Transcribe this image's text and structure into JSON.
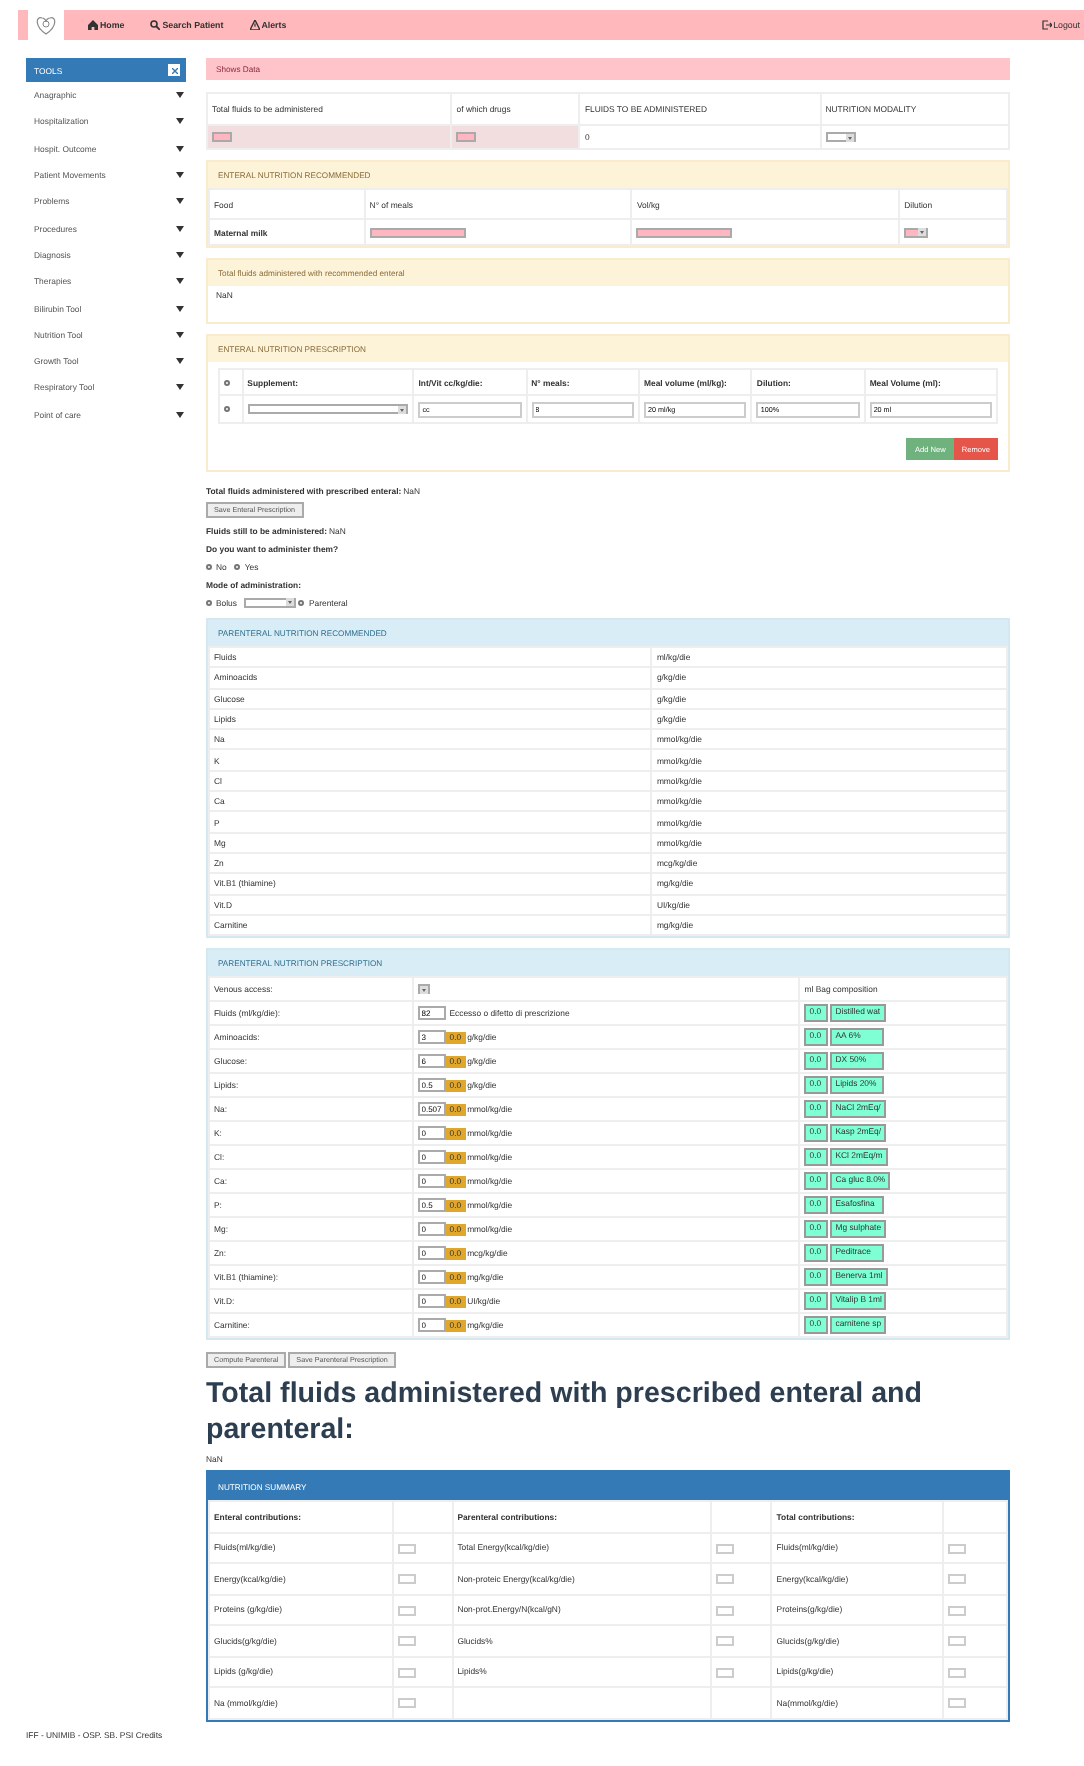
{
  "nav": {
    "links": [
      {
        "kind": "home",
        "label": "Home"
      },
      {
        "kind": "search",
        "label": "Search Patient"
      },
      {
        "kind": "alert",
        "label": "Alerts"
      }
    ],
    "logout": "Logout"
  },
  "sidebar": {
    "title": "TOOLS",
    "items": [
      "Anagraphic",
      "Hospitalization",
      "Hospit. Outcome",
      "Patient Movements",
      "Problems",
      "Procedures",
      "Diagnosis",
      "Therapies",
      "Bilirubin Tool",
      "Nutrition Tool",
      "Growth Tool",
      "Respiratory Tool",
      "Point of care"
    ]
  },
  "shows_data": {
    "title": "Shows Data",
    "columns": [
      "Total fluids to be administered",
      "of which drugs",
      "FLUIDS TO BE ADMINISTERED",
      "NUTRITION MODALITY"
    ],
    "fluids_value": "0"
  },
  "enteral_recommended": {
    "title": "ENTERAL NUTRITION RECOMMENDED",
    "columns": [
      "Food",
      "N° of meals",
      "Vol/kg",
      "Dilution"
    ],
    "food": "Maternal milk"
  },
  "recommended_total": {
    "title": "Total fluids administered with recommended enteral",
    "value": "NaN"
  },
  "enteral_prescription": {
    "title": "ENTERAL NUTRITION PRESCRIPTION",
    "checked": false,
    "columns": [
      "Supplement:",
      "Int/Vit cc/kg/die:",
      "N° meals:",
      "Meal volume (ml/kg):",
      "Dilution:",
      "Meal Volume (ml):"
    ],
    "row": {
      "checked": false,
      "values": [
        "cc",
        "8",
        "20 ml/kg",
        "100%",
        "20 ml"
      ]
    },
    "buttons": [
      {
        "kind": "add",
        "label": "Add New"
      },
      {
        "kind": "remove",
        "label": "Remove"
      }
    ]
  },
  "prescribed_total": {
    "label": "Total fluids administered with prescribed enteral:",
    "value": "NaN"
  },
  "save_enteral": "Save Enteral Prescription",
  "fluids_left": {
    "label": "Fluids still to be administered:",
    "value": "NaN"
  },
  "administer": {
    "question": "Do you want to administer them?",
    "options": [
      {
        "label": "No",
        "selected": false
      },
      {
        "label": "Yes",
        "selected": false
      }
    ]
  },
  "mode": {
    "label": "Mode of administration:",
    "options": [
      {
        "label": "Bolus",
        "selected": false
      },
      {
        "label": "Parenteral",
        "selected": false
      }
    ]
  },
  "parenteral_recommended": {
    "title": "PARENTERAL NUTRITION RECOMMENDED",
    "rows": [
      {
        "name": "Fluids",
        "unit": "ml/kg/die"
      },
      {
        "name": "Aminoacids",
        "unit": "g/kg/die"
      },
      {
        "name": "Glucose",
        "unit": "g/kg/die"
      },
      {
        "name": "Lipids",
        "unit": "g/kg/die"
      },
      {
        "name": "Na",
        "unit": "mmol/kg/die"
      },
      {
        "name": "K",
        "unit": "mmol/kg/die"
      },
      {
        "name": "Cl",
        "unit": "mmol/kg/die"
      },
      {
        "name": "Ca",
        "unit": "mmol/kg/die"
      },
      {
        "name": "P",
        "unit": "mmol/kg/die"
      },
      {
        "name": "Mg",
        "unit": "mmol/kg/die"
      },
      {
        "name": "Zn",
        "unit": "mcg/kg/die"
      },
      {
        "name": "Vit.B1 (thiamine)",
        "unit": "mg/kg/die"
      },
      {
        "name": "Vit.D",
        "unit": "UI/kg/die"
      },
      {
        "name": "Carnitine",
        "unit": "mg/kg/die"
      }
    ]
  },
  "parenteral_prescription": {
    "title": "PARENTERAL NUTRITION PRESCRIPTION",
    "venous_label": "Venous access:",
    "bag_label": "ml Bag composition",
    "fluids": {
      "name": "Fluids (ml/kg/die):",
      "value": "82",
      "note": "Eccesso o difetto di prescrizione",
      "bag_ml": "0.0",
      "bag_item": "Distilled wat"
    },
    "rows": [
      {
        "name": "Aminoacids:",
        "value": "3",
        "computed": "0.0",
        "unit": "g/kg/die",
        "bag_ml": "0.0",
        "bag_item": "AA 6%"
      },
      {
        "name": "Glucose:",
        "value": "6",
        "computed": "0.0",
        "unit": "g/kg/die",
        "bag_ml": "0.0",
        "bag_item": "DX 50%"
      },
      {
        "name": "Lipids:",
        "value": "0.5",
        "computed": "0.0",
        "unit": "g/kg/die",
        "bag_ml": "0.0",
        "bag_item": "Lipids 20%"
      },
      {
        "name": "Na:",
        "value": "0.507",
        "computed": "0.0",
        "unit": "mmol/kg/die",
        "bag_ml": "0.0",
        "bag_item": "NaCl 2mEq/"
      },
      {
        "name": "K:",
        "value": "0",
        "computed": "0.0",
        "unit": "mmol/kg/die",
        "bag_ml": "0.0",
        "bag_item": "Kasp 2mEq/"
      },
      {
        "name": "Cl:",
        "value": "0",
        "computed": "0.0",
        "unit": "mmol/kg/die",
        "bag_ml": "0.0",
        "bag_item": "KCl 2mEq/m"
      },
      {
        "name": "Ca:",
        "value": "0",
        "computed": "0.0",
        "unit": "mmol/kg/die",
        "bag_ml": "0.0",
        "bag_item": "Ca gluc 8.0%"
      },
      {
        "name": "P:",
        "value": "0.5",
        "computed": "0.0",
        "unit": "mmol/kg/die",
        "bag_ml": "0.0",
        "bag_item": "Esafosfina"
      },
      {
        "name": "Mg:",
        "value": "0",
        "computed": "0.0",
        "unit": "mmol/kg/die",
        "bag_ml": "0.0",
        "bag_item": "Mg sulphate"
      },
      {
        "name": "Zn:",
        "value": "0",
        "computed": "0.0",
        "unit": "mcg/kg/die",
        "bag_ml": "0.0",
        "bag_item": "Peditrace"
      },
      {
        "name": "Vit.B1 (thiamine):",
        "value": "0",
        "computed": "0.0",
        "unit": "mg/kg/die",
        "bag_ml": "0.0",
        "bag_item": "Benerva 1ml"
      },
      {
        "name": "Vit.D:",
        "value": "0",
        "computed": "0.0",
        "unit": "UI/kg/die",
        "bag_ml": "0.0",
        "bag_item": "Vitalip B 1ml"
      },
      {
        "name": "Carnitine:",
        "value": "0",
        "computed": "0.0",
        "unit": "mg/kg/die",
        "bag_ml": "0.0",
        "bag_item": "carnitene sp"
      }
    ]
  },
  "parenteral_buttons": [
    "Compute Parenteral",
    "Save Parenteral Prescription"
  ],
  "total_heading": "Total fluids administered with prescribed enteral and parenteral:",
  "total_value": "NaN",
  "summary": {
    "title": "NUTRITION SUMMARY",
    "headers": [
      "Enteral contributions:",
      "Parenteral contributions:",
      "Total contributions:"
    ],
    "rows": [
      {
        "enteral": "Fluids(ml/kg/die)",
        "parenteral": "Total Energy(kcal/kg/die)",
        "total": "Fluids(ml/kg/die)"
      },
      {
        "enteral": "Energy(kcal/kg/die)",
        "parenteral": "Non-proteic Energy(kcal/kg/die)",
        "total": "Energy(kcal/kg/die)"
      },
      {
        "enteral": "Proteins (g/kg/die)",
        "parenteral": "Non-prot.Energy/N(kcal/gN)",
        "total": "Proteins(g/kg/die)"
      },
      {
        "enteral": "Glucids(g/kg/die)",
        "parenteral": "Glucids%",
        "total": "Glucids(g/kg/die)"
      },
      {
        "enteral": "Lipids (g/kg/die)",
        "parenteral": "Lipids%",
        "total": "Lipids(g/kg/die)"
      },
      {
        "enteral": "Na (mmol/kg/die)",
        "total": "Na(mmol/kg/die)"
      }
    ]
  },
  "footer": "IFF - UNIMIB - OSP. SB. PSI Credits"
}
